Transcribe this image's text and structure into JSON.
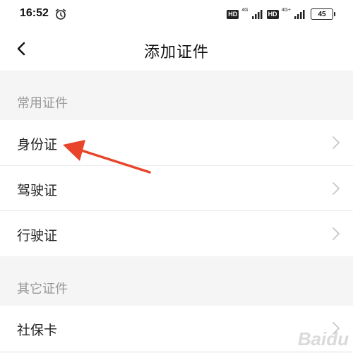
{
  "status_bar": {
    "time": "16:52",
    "hd1": "HD",
    "net1": "4G",
    "hd2": "HD",
    "net2": "4G+",
    "battery": "45",
    "icons": [
      "alarm-icon",
      "signal-icon",
      "battery-icon"
    ]
  },
  "nav": {
    "title": "添加证件",
    "back_icon": "chevron-left-icon"
  },
  "sections": [
    {
      "header": "常用证件",
      "items": [
        {
          "label": "身份证"
        },
        {
          "label": "驾驶证"
        },
        {
          "label": "行驶证"
        }
      ]
    },
    {
      "header": "其它证件",
      "items": [
        {
          "label": "社保卡"
        }
      ]
    }
  ],
  "annotation": {
    "color": "#e8452b",
    "icon": "red-arrow"
  },
  "watermark": {
    "text": "Baidu"
  },
  "colors": {
    "page_bg": "#f5f5f5",
    "row_bg": "#ffffff",
    "section_text": "#999999",
    "chevron": "#c4c4c4"
  }
}
